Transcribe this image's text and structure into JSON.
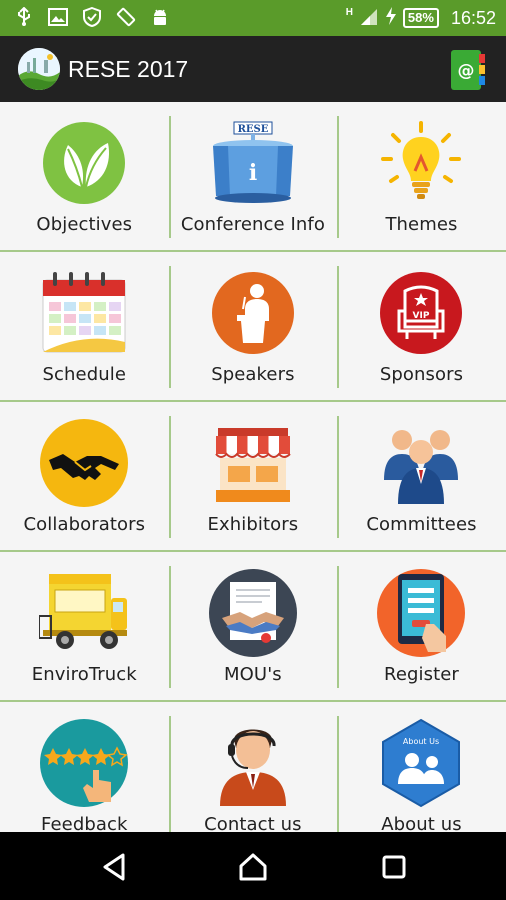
{
  "status_bar": {
    "icons": [
      "usb-icon",
      "image-icon",
      "shield-check-icon",
      "screen-rotation-icon",
      "android-icon"
    ],
    "network": "H",
    "battery": "58%",
    "time": "16:52"
  },
  "app_bar": {
    "title": "RESE 2017",
    "logo": "rese-logo",
    "contact_icon": "contact-book-icon"
  },
  "tiles": [
    {
      "label": "Objectives",
      "icon": "leaf-icon"
    },
    {
      "label": "Conference Info",
      "icon": "info-desk-icon",
      "sign": "RESE",
      "glyph": "i"
    },
    {
      "label": "Themes",
      "icon": "lightbulb-icon"
    },
    {
      "label": "Schedule",
      "icon": "calendar-icon"
    },
    {
      "label": "Speakers",
      "icon": "podium-speaker-icon"
    },
    {
      "label": "Sponsors",
      "icon": "vip-chair-icon",
      "badge": "VIP"
    },
    {
      "label": "Collaborators",
      "icon": "handshake-icon"
    },
    {
      "label": "Exhibitors",
      "icon": "storefront-icon"
    },
    {
      "label": "Committees",
      "icon": "people-group-icon"
    },
    {
      "label": "EnviroTruck",
      "icon": "truck-icon"
    },
    {
      "label": "MOU's",
      "icon": "agreement-document-icon"
    },
    {
      "label": "Register",
      "icon": "tablet-register-icon"
    },
    {
      "label": "Feedback",
      "icon": "star-rating-icon"
    },
    {
      "label": "Contact us",
      "icon": "support-agent-icon"
    },
    {
      "label": "About us",
      "icon": "about-us-icon",
      "caption": "About Us"
    }
  ],
  "nav_bar": {
    "back": "back-icon",
    "home": "home-icon",
    "recents": "recents-icon"
  }
}
